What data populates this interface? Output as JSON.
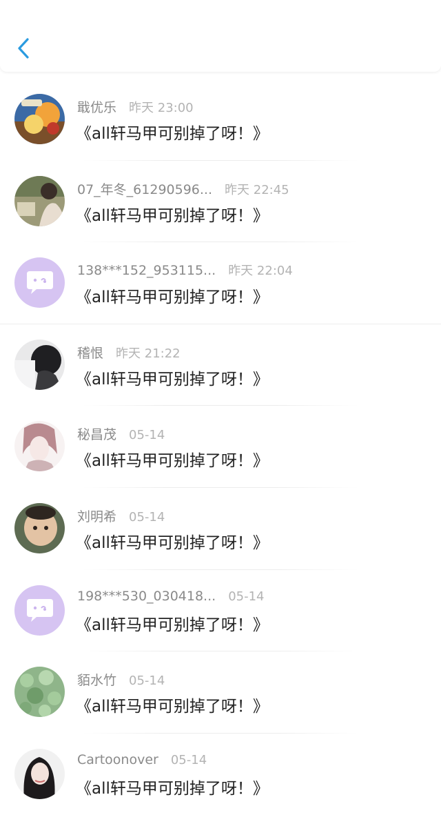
{
  "header": {
    "back_icon": "chevron-left-icon",
    "accent": "#2a9be0"
  },
  "messages": [
    {
      "name": "戢优乐",
      "time": "昨天 23:00",
      "text": "《all轩马甲可别掉了呀！》",
      "avatar": "cartoon-avatar"
    },
    {
      "name": "07_年冬_61290596...",
      "time": "昨天 22:45",
      "text": "《all轩马甲可别掉了呀！》",
      "avatar": "photo-avatar"
    },
    {
      "name": "138***152_953115...",
      "time": "昨天 22:04",
      "text": "《all轩马甲可别掉了呀！》",
      "avatar": "default-chat-avatar"
    },
    {
      "name": "稽恨",
      "time": "昨天 21:22",
      "text": "《all轩马甲可别掉了呀！》",
      "avatar": "photo-avatar"
    },
    {
      "name": "秘昌茂",
      "time": "05-14",
      "text": "《all轩马甲可别掉了呀！》",
      "avatar": "anime-avatar"
    },
    {
      "name": "刘明希",
      "time": "05-14",
      "text": "《all轩马甲可别掉了呀！》",
      "avatar": "baby-photo-avatar"
    },
    {
      "name": "198***530_030418...",
      "time": "05-14",
      "text": "《all轩马甲可别掉了呀！》",
      "avatar": "default-chat-avatar"
    },
    {
      "name": "貊水竹",
      "time": "05-14",
      "text": "《all轩马甲可别掉了呀！》",
      "avatar": "clover-avatar"
    },
    {
      "name": "Cartoonover",
      "time": "05-14",
      "text": "《all轩马甲可别掉了呀！》",
      "avatar": "portrait-avatar"
    }
  ],
  "colors": {
    "default_avatar_bg": "#d6c4f2",
    "name": "#8a8a8a",
    "time": "#b3b3b3",
    "text": "#222222"
  }
}
